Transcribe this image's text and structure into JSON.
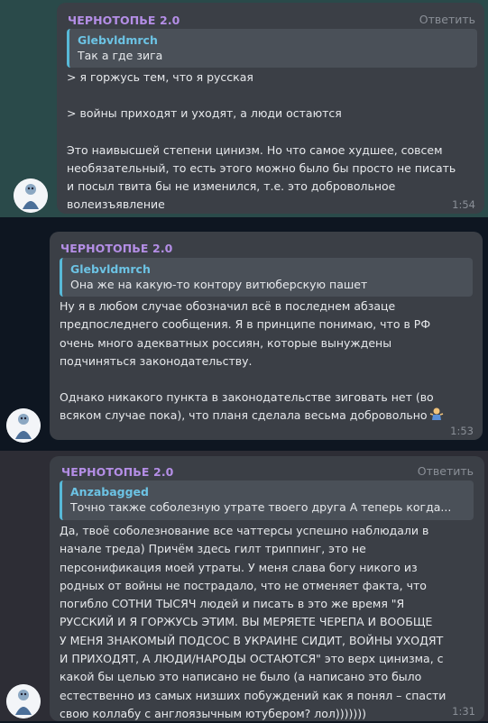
{
  "messages": [
    {
      "sender": "ЧЕРНОТОПЬЕ 2.0",
      "reply_label": "Ответить",
      "quote_author": "Glebvldmrch",
      "quote_text": "Так а где зига",
      "lines": [
        "> я горжусь тем, что я русская",
        "",
        "> войны приходят и уходят, а люди остаются",
        "",
        "Это наивысшей степени цинизм. Но что самое худшее, совсем",
        "необязательный, то есть этого можно было бы просто не писать",
        "и посыл твита бы не изменился, т.е. это добровольное",
        "волеизъявление"
      ],
      "time": "1:54"
    },
    {
      "sender": "ЧЕРНОТОПЬЕ 2.0",
      "quote_author": "Glebvldmrch",
      "quote_text": "Она же на какую-то контору витюберскую пашет",
      "lines": [
        "Ну я в любом случае обозначил всё в последнем абзаце",
        "предпоследнего сообщения. Я в принципе понимаю, что в РФ",
        "очень много адекватных россиян, которые вынуждены",
        "подчиняться законодательству.",
        "",
        "Однако никакого пункта в законодательстве зиговать нет (во",
        "всяком случае пока), что планя сделала весьма добровольно"
      ],
      "emoji": "shrug-emoji",
      "time": "1:53"
    },
    {
      "sender": "ЧЕРНОТОПЬЕ 2.0",
      "reply_label": "Ответить",
      "quote_author": "Anzabagged",
      "quote_text": "Точно также соболезную утрате твоего друга А теперь когда...",
      "lines": [
        "Да, твоё соболезнование все чаттерсы успешно наблюдали в",
        "начале треда) Причём здесь гилт триппинг, это не",
        "персонификация моей утраты. У меня слава богу никого из",
        "родных от войны не пострадало, что не отменяет факта, что",
        "погибло СОТНИ ТЫСЯЧ людей и писать в это же время \"Я",
        "РУССКИЙ И Я ГОРЖУСЬ ЭТИМ. ВЫ МЕРЯЕТЕ ЧЕРЕПА И ВООБЩЕ",
        "У МЕНЯ ЗНАКОМЫЙ ПОДСОС В УКРАИНЕ СИДИТ, ВОЙНЫ УХОДЯТ",
        "И ПРИХОДЯТ, А ЛЮДИ/НАРОДЫ ОСТАЮТСЯ\" это верх цинизма, с",
        "какой бы целью это написано не было (а написано это было",
        "естественно из самых низших побуждений как я понял – спасти",
        "свою коллабу с англоязычным ютубером? лол)))))))"
      ],
      "time": "1:31"
    }
  ],
  "colors": {
    "sender": "#b48ee6",
    "quote_bar": "#57b9d8",
    "quote_author": "#6cc3e4",
    "bubble": "#3b3f46",
    "highlight_bg": "#2a4a4a"
  }
}
